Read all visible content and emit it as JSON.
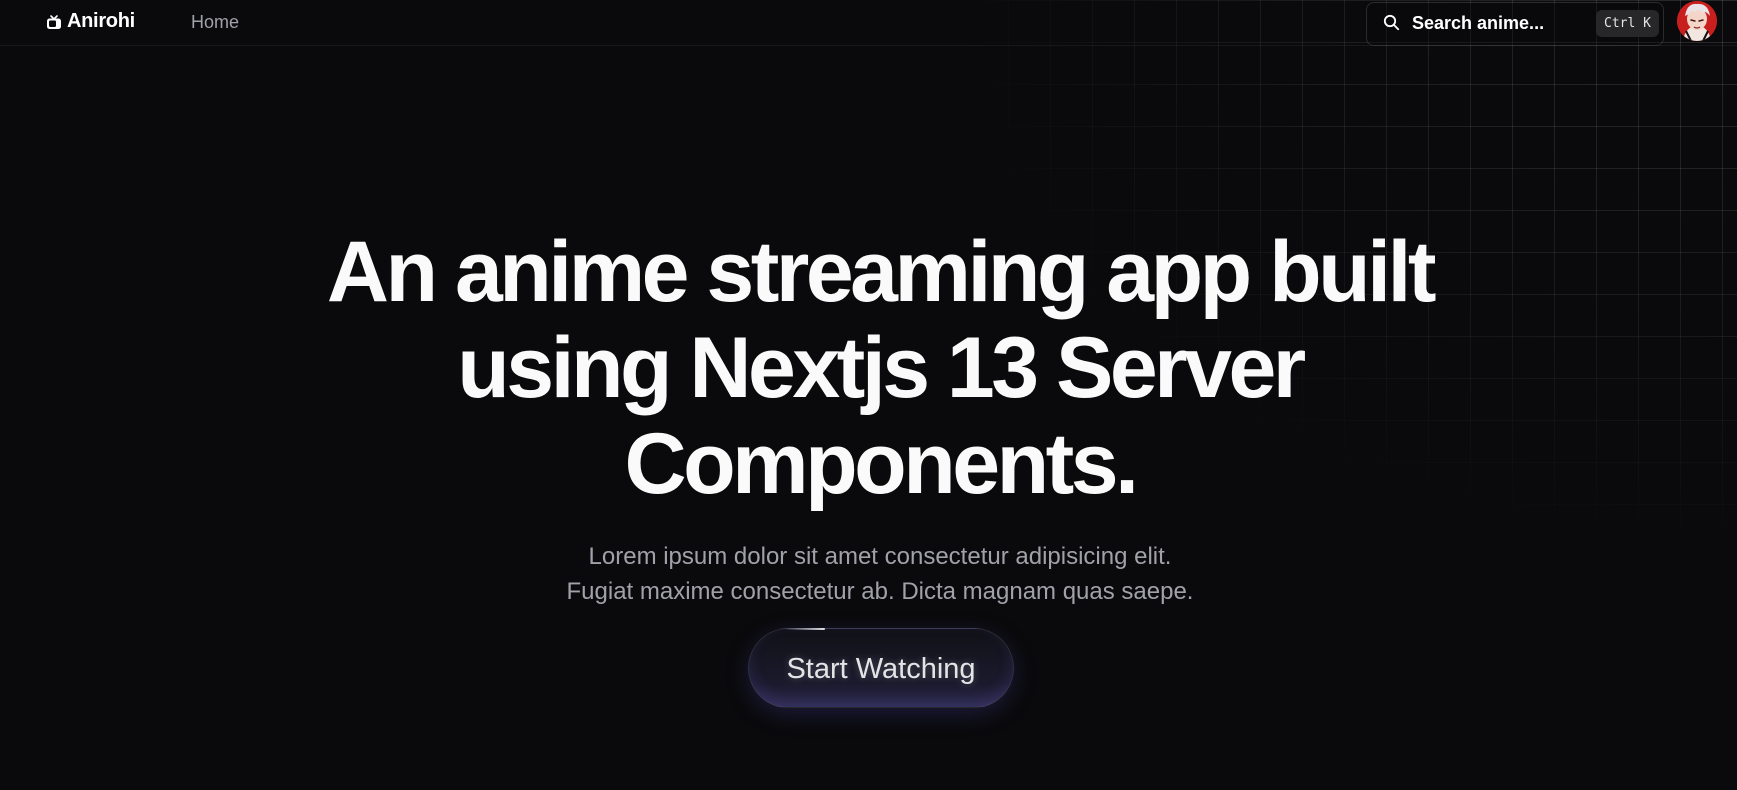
{
  "header": {
    "brand_name": "Anirohi",
    "nav": [
      {
        "label": "Home"
      }
    ],
    "search": {
      "placeholder": "Search anime...",
      "shortcut": "Ctrl K"
    },
    "icons": {
      "brand": "tv-icon",
      "search": "search-icon",
      "avatar": "user-avatar"
    }
  },
  "hero": {
    "title_lines": [
      "An anime streaming app built",
      "using Nextjs 13 Server",
      "Components."
    ],
    "subtitle_lines": [
      "Lorem ipsum dolor sit amet consectetur adipisicing elit.",
      "Fugiat maxime consectetur ab. Dicta magnam quas saepe."
    ],
    "cta_label": "Start Watching"
  },
  "colors": {
    "background": "#0a0a0c",
    "heading": "#fafafa",
    "muted_text": "#a1a1aa",
    "cta_glow": "#2a2848",
    "avatar_accent": "#c81e1e"
  }
}
